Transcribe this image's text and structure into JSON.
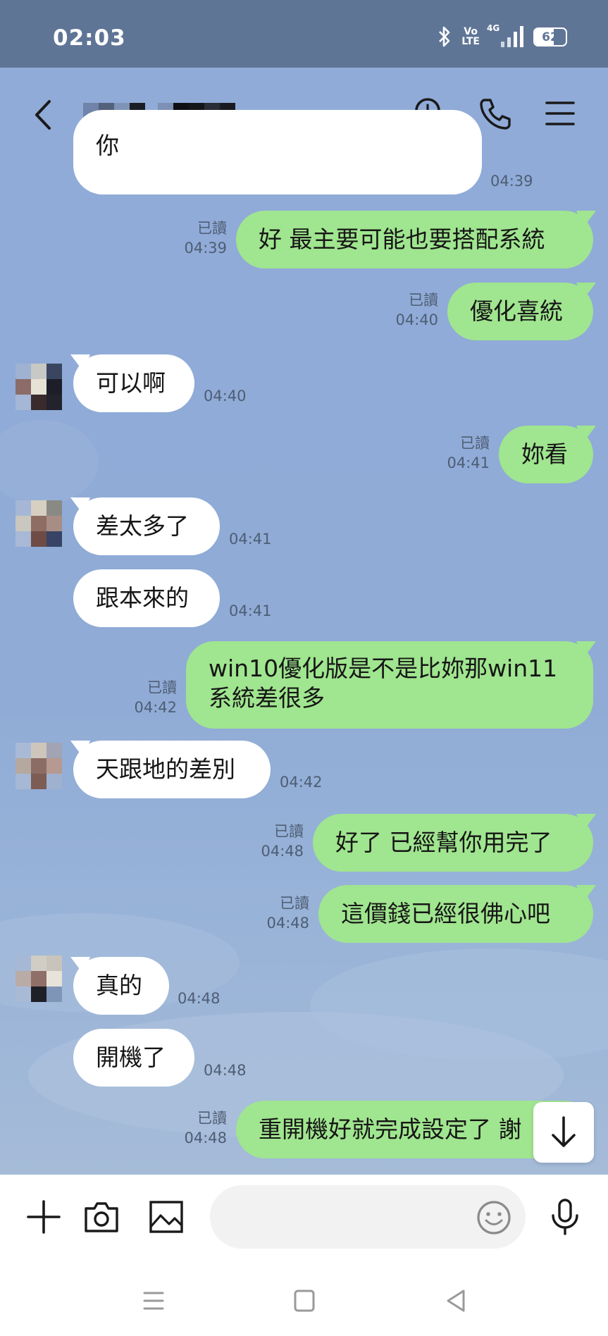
{
  "status_bar": {
    "time": "02:03",
    "volte_top": "Vo",
    "volte_bottom": "LTE",
    "network": "4G",
    "battery": "62",
    "battery_level": 0.62
  },
  "header": {
    "title_redacted": true,
    "icons": [
      "back-icon",
      "search-icon",
      "phone-icon",
      "menu-icon"
    ]
  },
  "messages": [
    {
      "dir": "in",
      "text": "你",
      "time": "04:39"
    },
    {
      "dir": "out",
      "text": "好 最主要可能也要搭配系統",
      "read": "已讀",
      "time": "04:39"
    },
    {
      "dir": "out",
      "text": "優化喜統",
      "read": "已讀",
      "time": "04:40"
    },
    {
      "dir": "in",
      "text": "可以啊",
      "time": "04:40"
    },
    {
      "dir": "out",
      "text": "妳看",
      "read": "已讀",
      "time": "04:41"
    },
    {
      "dir": "in",
      "text": "差太多了",
      "time": "04:41"
    },
    {
      "dir": "in",
      "text": "跟本來的",
      "time": "04:41"
    },
    {
      "dir": "out",
      "text": "win10優化版是不是比妳那win11",
      "text2": "系統差很多",
      "read": "已讀",
      "time": "04:42"
    },
    {
      "dir": "in",
      "text": "天跟地的差別",
      "time": "04:42"
    },
    {
      "dir": "out",
      "text": "好了 已經幫你用完了",
      "read": "已讀",
      "time": "04:48"
    },
    {
      "dir": "out",
      "text": "這價錢已經很佛心吧",
      "read": "已讀",
      "time": "04:48"
    },
    {
      "dir": "in",
      "text": "真的",
      "time": "04:48"
    },
    {
      "dir": "in",
      "text": "開機了",
      "time": "04:48"
    },
    {
      "dir": "out",
      "text": "重開機好就完成設定了 謝",
      "read": "已讀",
      "time": "04:48"
    }
  ],
  "input_bar": {
    "placeholder": "",
    "icons": [
      "plus-icon",
      "camera-icon",
      "image-icon",
      "emoji-icon",
      "mic-icon"
    ]
  },
  "colors": {
    "background": "#8fabd6",
    "outgoing_bubble": "#a0e58f",
    "incoming_bubble": "#ffffff",
    "status_bar": "#5f7596"
  }
}
